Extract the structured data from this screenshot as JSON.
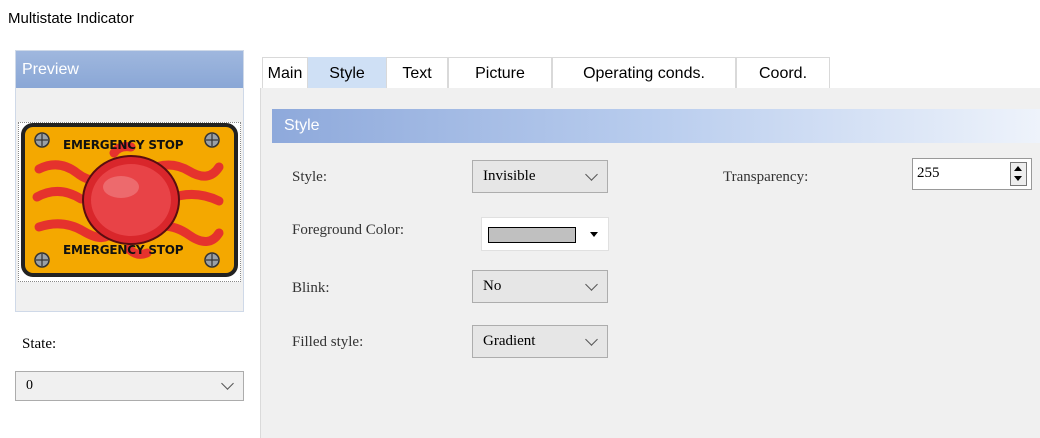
{
  "window": {
    "title": "Multistate Indicator"
  },
  "preview": {
    "header": "Preview",
    "image": {
      "name": "emergency-stop-button-image",
      "top_text": "EMERGENCY STOP",
      "bottom_text": "EMERGENCY STOP"
    }
  },
  "state": {
    "label": "State:",
    "value": "0"
  },
  "tabs": [
    {
      "label": "Main",
      "active": false
    },
    {
      "label": "Style",
      "active": true
    },
    {
      "label": "Text",
      "active": false
    },
    {
      "label": "Picture",
      "active": false
    },
    {
      "label": "Operating conds.",
      "active": false
    },
    {
      "label": "Coord.",
      "active": false
    }
  ],
  "section": {
    "title": "Style"
  },
  "fields": {
    "style": {
      "label": "Style:",
      "value": "Invisible"
    },
    "foreground": {
      "label": "Foreground Color:",
      "color": "#c0c0c0"
    },
    "blink": {
      "label": "Blink:",
      "value": "No"
    },
    "filled": {
      "label": "Filled style:",
      "value": "Gradient"
    },
    "transparency": {
      "label": "Transparency:",
      "value": "255"
    }
  },
  "colors": {
    "header_blue": "#8ea9db",
    "active_tab": "#cfe0f5",
    "panel_bg": "#f0f0f0"
  }
}
